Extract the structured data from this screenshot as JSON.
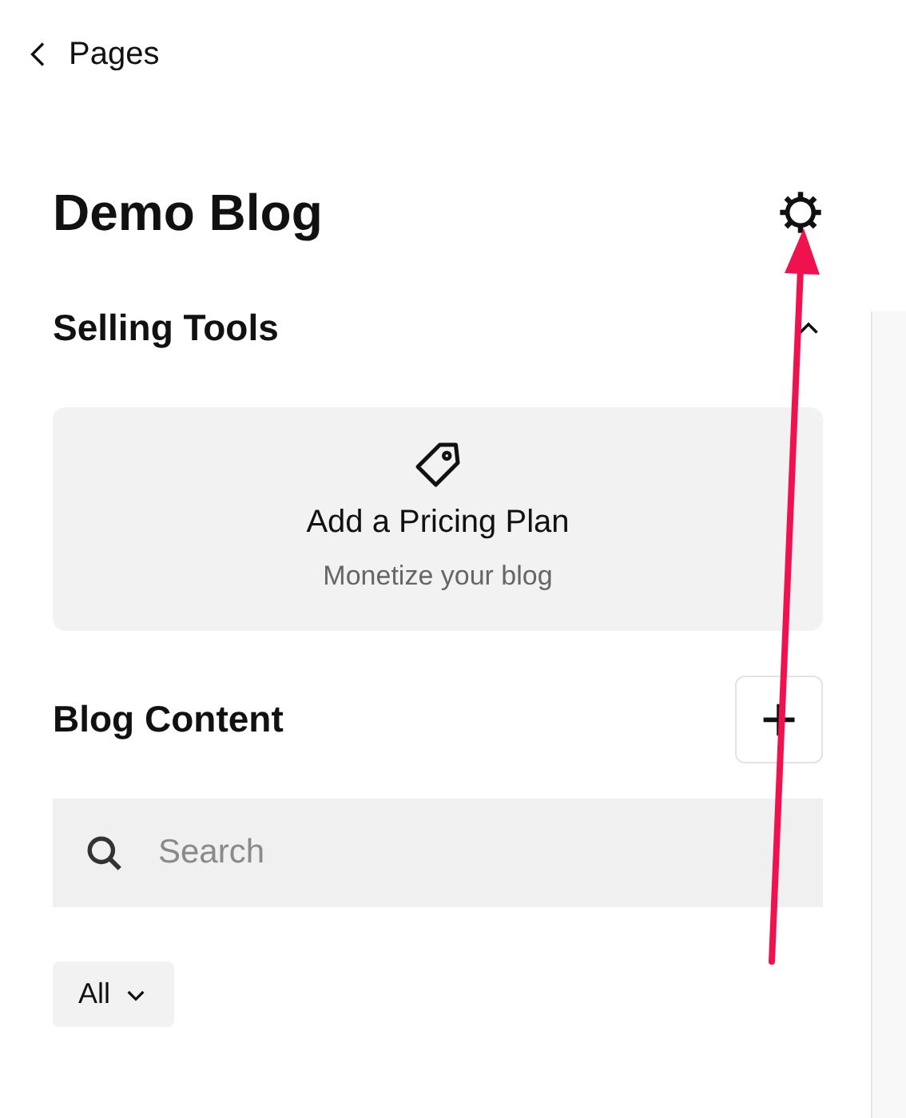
{
  "back_link": {
    "label": "Pages"
  },
  "title": "Demo Blog",
  "selling_tools": {
    "heading": "Selling Tools",
    "expanded": true,
    "card": {
      "title": "Add a Pricing Plan",
      "subtitle": "Monetize your blog"
    }
  },
  "blog_content": {
    "heading": "Blog Content",
    "add_button": "+"
  },
  "search": {
    "placeholder": "Search"
  },
  "filter": {
    "label": "All"
  },
  "annotation": {
    "kind": "arrow"
  }
}
